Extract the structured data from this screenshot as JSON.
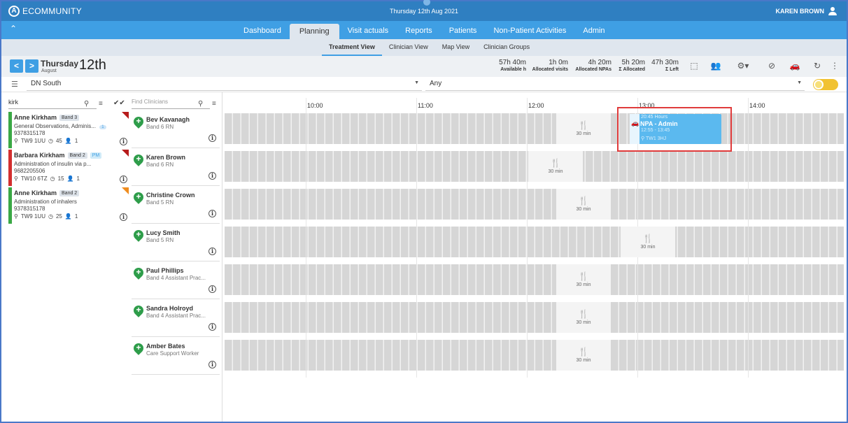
{
  "app": {
    "logo_letter": "A",
    "name": "ECOMMUNITY",
    "date": "Thursday 12th Aug 2021",
    "user": "KAREN BROWN"
  },
  "nav": {
    "collapse": "⌃",
    "tabs": [
      "Dashboard",
      "Planning",
      "Visit actuals",
      "Reports",
      "Patients",
      "Non-Patient Activities",
      "Admin"
    ],
    "active": "Planning"
  },
  "subnav": {
    "tabs": [
      "Treatment View",
      "Clinician View",
      "Map View",
      "Clinician Groups"
    ],
    "active": "Treatment View"
  },
  "datebar": {
    "prev": "<",
    "next": ">",
    "day": "Thursday",
    "month": "August",
    "date_num": "12th",
    "stats": [
      {
        "value": "57h 40m",
        "label": "Available h"
      },
      {
        "value": "1h 0m",
        "label": "Allocated visits"
      },
      {
        "value": "4h 20m",
        "label": "Allocated NPAs"
      },
      {
        "value": "5h 20m",
        "label": "Σ Allocated"
      },
      {
        "value": "47h 30m",
        "label": "Σ Left"
      }
    ]
  },
  "filters": {
    "area": "DN South",
    "second": "Any"
  },
  "patients": {
    "search_value": "kirk",
    "items": [
      {
        "name": "Anne Kirkham",
        "band": "Band 3",
        "pm": "",
        "desc": "General Observations, Adminis...",
        "count": "1",
        "nhs": "9378315178",
        "postcode": "TW9 1UU",
        "mins": "45",
        "people": "1",
        "stripe": "#3aa845",
        "corner": "#b71c1c"
      },
      {
        "name": "Barbara Kirkham",
        "band": "Band 2",
        "pm": "PM",
        "desc": "Administration of insulin via p...",
        "count": "",
        "nhs": "9682205506",
        "postcode": "TW10 6TZ",
        "mins": "15",
        "people": "1",
        "stripe": "#d32f2f",
        "corner": "#b71c1c"
      },
      {
        "name": "Anne Kirkham",
        "band": "Band 2",
        "pm": "",
        "desc": "Administration of inhalers",
        "count": "",
        "nhs": "9378315178",
        "postcode": "TW9 1UU",
        "mins": "25",
        "people": "1",
        "stripe": "#3aa845",
        "corner": "#ef8c1e"
      }
    ]
  },
  "clinicians": {
    "search_placeholder": "Find Clinicians",
    "items": [
      {
        "name": "Bev Kavanagh",
        "band": "Band 6 RN"
      },
      {
        "name": "Karen Brown",
        "band": "Band 6 RN"
      },
      {
        "name": "Christine Crown",
        "band": "Band 5 RN"
      },
      {
        "name": "Lucy Smith",
        "band": "Band 5 RN"
      },
      {
        "name": "Paul Phillips",
        "band": "Band 4 Assistant Prac..."
      },
      {
        "name": "Sandra Holroyd",
        "band": "Band 4 Assistant Prac..."
      },
      {
        "name": "Amber Bates",
        "band": "Care Support Worker"
      }
    ]
  },
  "timeline": {
    "hours": [
      "10:00",
      "11:00",
      "12:00",
      "13:00",
      "14:00"
    ],
    "lunch_label": "30 min",
    "npa": {
      "hours": "20:45 Hours",
      "title": "NPA - Admin",
      "time": "12:55 - 13:45",
      "location": "TW1 3HJ"
    }
  }
}
